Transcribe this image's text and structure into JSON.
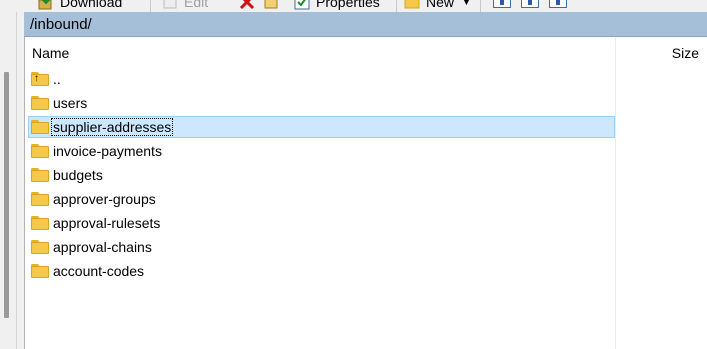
{
  "toolbar": {
    "download_label": "Download",
    "edit_label": "Edit",
    "properties_label": "Properties",
    "new_label": "New"
  },
  "path": "/inbound/",
  "columns": {
    "name": "Name",
    "size": "Size"
  },
  "items": [
    {
      "label": "..",
      "icon": "parent-folder-icon"
    },
    {
      "label": "users",
      "icon": "folder-icon"
    },
    {
      "label": "supplier-addresses",
      "icon": "folder-icon",
      "selected": true
    },
    {
      "label": "invoice-payments",
      "icon": "folder-icon"
    },
    {
      "label": "budgets",
      "icon": "folder-icon"
    },
    {
      "label": "approver-groups",
      "icon": "folder-icon"
    },
    {
      "label": "approval-rulesets",
      "icon": "folder-icon"
    },
    {
      "label": "approval-chains",
      "icon": "folder-icon"
    },
    {
      "label": "account-codes",
      "icon": "folder-icon"
    }
  ],
  "colors": {
    "path_bar": "#a6bfd9",
    "selection": "#cce8ff",
    "folder": "#f5c84a"
  }
}
